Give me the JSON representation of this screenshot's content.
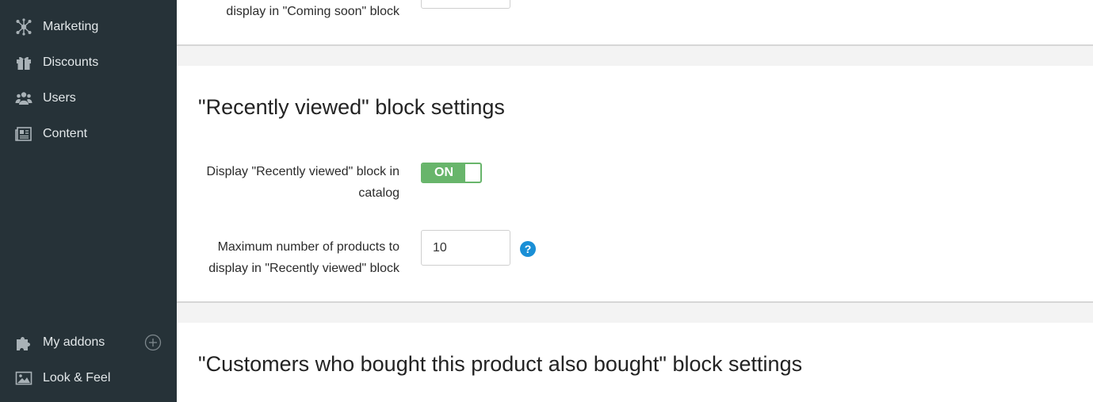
{
  "sidebar": {
    "items": [
      {
        "label": "Marketing",
        "icon": "marketing-icon"
      },
      {
        "label": "Discounts",
        "icon": "gift-icon"
      },
      {
        "label": "Users",
        "icon": "users-icon"
      },
      {
        "label": "Content",
        "icon": "content-icon"
      },
      {
        "label": "My addons",
        "icon": "puzzle-icon"
      },
      {
        "label": "Look & Feel",
        "icon": "image-icon"
      }
    ]
  },
  "top_section": {
    "label_tail": "display in \"Coming soon\" block"
  },
  "recent": {
    "title": "\"Recently viewed\" block settings",
    "display_label": "Display \"Recently viewed\" block in catalog",
    "toggle_state": "ON",
    "max_label": "Maximum number of products to display in \"Recently viewed\" block",
    "max_value": "10",
    "help_icon": "?"
  },
  "customers": {
    "title": "\"Customers who bought this product also bought\" block settings"
  },
  "colors": {
    "sidebar_bg": "#263238",
    "toggle_on": "#68b56b",
    "help": "#1a8fd6"
  }
}
